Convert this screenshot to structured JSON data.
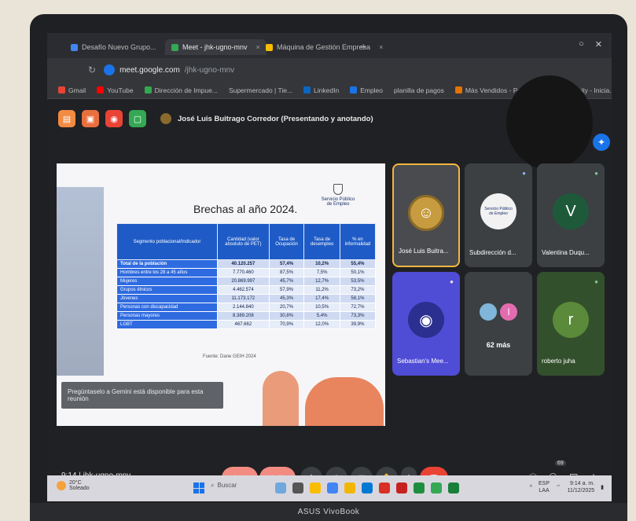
{
  "browser": {
    "tabs": [
      {
        "label": "Desafío Nuevo Grupo...",
        "color": "#4285f4",
        "active": false
      },
      {
        "label": "Meet - jhk-ugno-mnv",
        "color": "#34a853",
        "active": true
      },
      {
        "label": "Máquina de Gestión Empresa",
        "color": "#fbbc04",
        "active": false
      }
    ],
    "new_tab": "+",
    "url_host": "meet.google.com",
    "url_path": "/jhk-ugno-mnv",
    "bookmarks": [
      {
        "label": "Gmail",
        "color": "#ea4335"
      },
      {
        "label": "YouTube",
        "color": "#ff0000"
      },
      {
        "label": "Dirección de Impue...",
        "color": "#34a853"
      },
      {
        "label": "Supermercado | Tie...",
        "color": "#f29900"
      },
      {
        "label": "LinkedIn",
        "color": "#0a66c2"
      },
      {
        "label": "Empleo",
        "color": "#1a73e8"
      },
      {
        "label": "planilla de pagos",
        "color": "#9e9e9e"
      },
      {
        "label": "Más Vendidos - Pest...",
        "color": "#e37400"
      },
      {
        "label": "Opportunity - Inicia...",
        "color": "#9e9e9e"
      }
    ]
  },
  "presenter": {
    "buttons": [
      {
        "icon": "file-icon",
        "color": "#f28b43"
      },
      {
        "icon": "doc-icon",
        "color": "#ea6f3e"
      },
      {
        "icon": "record-icon",
        "color": "#ea4335"
      },
      {
        "icon": "present-icon",
        "color": "#34a853"
      }
    ],
    "text": "José Luis Buitrago Corredor (Presentando y anotando)"
  },
  "slide": {
    "title": "Brechas al año 2024.",
    "logo_line1": "Servicio Público",
    "logo_line2": "de Empleo",
    "table": {
      "headers": [
        "Segmento poblacional/Indicador",
        "Cantidad (valor absoluto de PET)",
        "Tasa de Ocupación",
        "Tasa de desempleo",
        "% en informalidad"
      ],
      "rows": [
        [
          "Total de la población",
          "40.120.257",
          "57,4%",
          "10,2%",
          "55,4%"
        ],
        [
          "Hombres entre los 28 a 45 años",
          "7.770.460",
          "87,5%",
          "7,5%",
          "50,1%"
        ],
        [
          "Mujeres",
          "20.869.997",
          "45,7%",
          "12,7%",
          "53,5%"
        ],
        [
          "Grupos étnicos",
          "4.462.574",
          "57,9%",
          "11,2%",
          "73,2%"
        ],
        [
          "Jóvenes",
          "11.173.172",
          "45,3%",
          "17,4%",
          "58,1%"
        ],
        [
          "Personas con discapacidad",
          "2.144.840",
          "20,7%",
          "10,5%",
          "72,7%"
        ],
        [
          "Personas mayores",
          "8.389.208",
          "30,8%",
          "5,4%",
          "73,3%"
        ],
        [
          "LGBT",
          "467.662",
          "70,9%",
          "12,0%",
          "39,9%"
        ]
      ]
    },
    "fuente": "Fuente: Dane GEIH 2024"
  },
  "gemini_tip": "Pregúntaselo a Gemini está disponible para esta reunión",
  "tiles": [
    {
      "name": "José Luis Buitra..."
    },
    {
      "name": "Subdirección d...",
      "logo_line1": "Servicio Público",
      "logo_line2": "de Empleo"
    },
    {
      "name": "Valentina Duqu...",
      "initial": "V"
    },
    {
      "name": "Sebastian's Mee..."
    },
    {
      "name": "62 más",
      "initial": "I"
    },
    {
      "name": "roberto juha",
      "initial": "r"
    }
  ],
  "controls": {
    "time": "9:14",
    "separator": "|",
    "meeting_code": "jhk-ugno-mnv",
    "participants_badge": "69"
  },
  "taskbar": {
    "weather_temp": "20°C",
    "weather_desc": "Soleado",
    "search_label": "Buscar",
    "lang1": "ESP",
    "lang2": "LAA",
    "clock_time": "9:14 a. m.",
    "clock_date": "11/12/2025"
  },
  "laptop_brand": "ASUS VivoBook"
}
